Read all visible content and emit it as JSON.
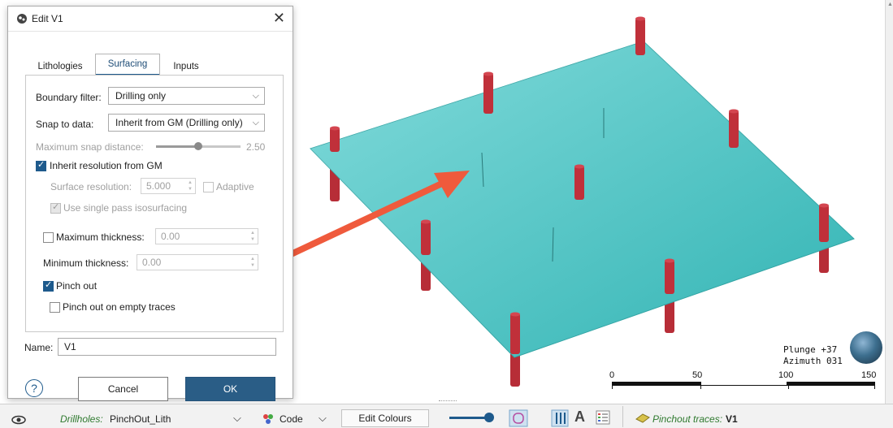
{
  "dialog": {
    "title": "Edit V1",
    "tabs": [
      {
        "label": "Lithologies"
      },
      {
        "label": "Surfacing"
      },
      {
        "label": "Inputs"
      }
    ],
    "boundary_filter": {
      "label": "Boundary filter:",
      "value": "Drilling only"
    },
    "snap_to_data": {
      "label": "Snap to data:",
      "value": "Inherit from GM (Drilling only)"
    },
    "max_snap": {
      "label": "Maximum snap distance:",
      "value": "2.50"
    },
    "inherit_resolution": {
      "label": "Inherit resolution from GM",
      "checked": true
    },
    "surface_resolution": {
      "label": "Surface resolution:",
      "value": "5.000"
    },
    "adaptive": {
      "label": "Adaptive"
    },
    "single_pass": {
      "label": "Use single pass isosurfacing"
    },
    "max_thickness": {
      "label": "Maximum thickness:",
      "value": "0.00"
    },
    "min_thickness": {
      "label": "Minimum thickness:",
      "value": "0.00"
    },
    "pinch_out": {
      "label": "Pinch out",
      "checked": true
    },
    "pinch_out_empty": {
      "label": "Pinch out on empty traces",
      "checked": false
    },
    "name": {
      "label": "Name:",
      "value": "V1"
    },
    "help": "?",
    "cancel": "Cancel",
    "ok": "OK"
  },
  "viewer": {
    "plunge": "Plunge +37",
    "azimuth": "Azimuth 031",
    "scale_labels": [
      "0",
      "50",
      "100",
      "150"
    ]
  },
  "statusbar": {
    "drillholes_label": "Drillholes:",
    "drillholes_value": "PinchOut_Lith",
    "code_label": "Code",
    "edit_colours": "Edit Colours",
    "pinchout_label": "Pinchout traces:",
    "pinchout_value": "V1"
  },
  "colors": {
    "surface": "#3cc6c6",
    "drillhole": "#c0303a",
    "arrow": "#ef5a3c",
    "accent": "#2a5d86"
  }
}
